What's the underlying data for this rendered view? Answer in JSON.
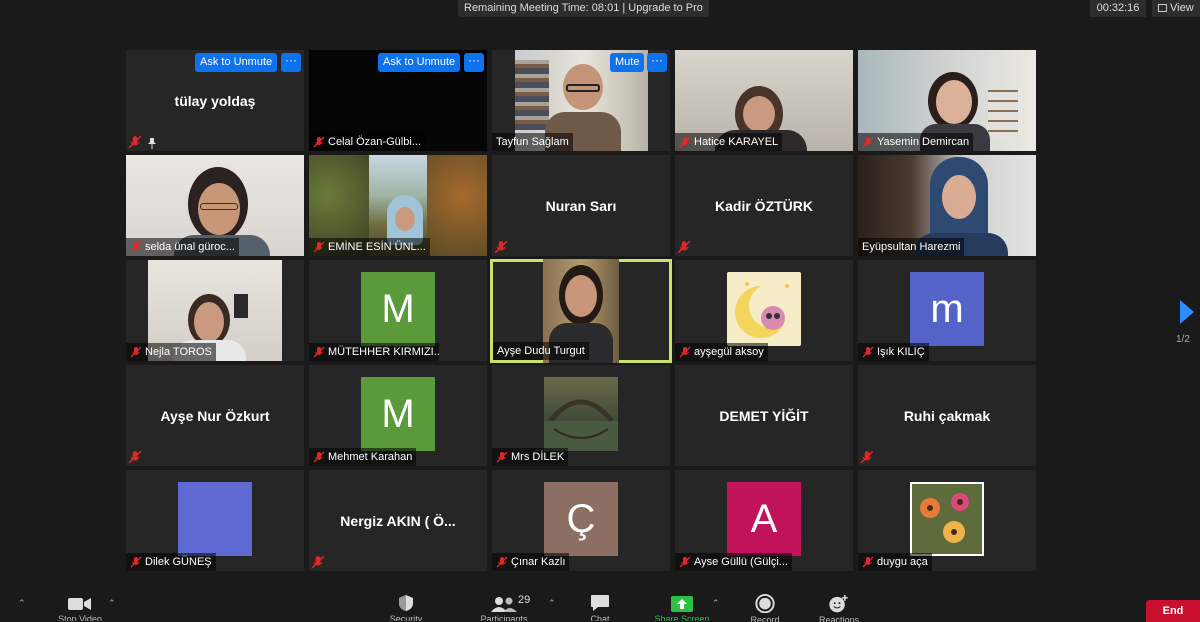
{
  "banner": "Remaining Meeting Time: 08:01 | Upgrade to Pro",
  "timer": "00:32:16",
  "view_label": "View",
  "page_indicator": "1/2",
  "buttons": {
    "ask_to_unmute": "Ask to Unmute",
    "mute": "Mute",
    "more": "···",
    "end": "End"
  },
  "participants": [
    {
      "name": "tülay yoldaş",
      "center_name": "tülay yoldaş"
    },
    {
      "name": "Celal Özan-Gülbi..."
    },
    {
      "name": "Tayfun Sağlam"
    },
    {
      "name": "Hatice KARAYEL"
    },
    {
      "name": "Yasemin Demircan"
    },
    {
      "name": "selda ünal güroc..."
    },
    {
      "name": "EMİNE ESİN ÜNL..."
    },
    {
      "name": "Nuran Sarı",
      "center_name": "Nuran Sarı"
    },
    {
      "name": "Kadir ÖZTÜRK",
      "center_name": "Kadir ÖZTÜRK"
    },
    {
      "name": "Eyüpsultan Harezmi"
    },
    {
      "name": "Nejla TOROS"
    },
    {
      "name": "MÜTEHHER KIRMIZI...",
      "avatar_letter": "M"
    },
    {
      "name": "Ayşe Dudu Turgut"
    },
    {
      "name": "ayşegül aksoy"
    },
    {
      "name": "Işık KILIÇ",
      "avatar_letter": "m"
    },
    {
      "name": "Ayşe Nur Özkurt",
      "center_name": "Ayşe Nur Özkurt"
    },
    {
      "name": "Mehmet Karahan",
      "avatar_letter": "M"
    },
    {
      "name": "Mrs DİLEK"
    },
    {
      "name": "DEMET YİĞİT",
      "center_name": "DEMET YİĞİT"
    },
    {
      "name": "Ruhi çakmak",
      "center_name": "Ruhi çakmak"
    },
    {
      "name": "Dilek GÜNEŞ"
    },
    {
      "name": "Nergiz AKIN ( Ö...",
      "center_name": "Nergiz AKIN ( Ö..."
    },
    {
      "name": "Çınar Kazlı",
      "avatar_letter": "Ç"
    },
    {
      "name": "Ayse Güllü (Gülçi...",
      "avatar_letter": "A"
    },
    {
      "name": "duygu açа"
    }
  ],
  "toolbar": {
    "participants_count": "29",
    "labels": {
      "stop_video": "Stop Video",
      "security": "Security",
      "participants": "Participants",
      "chat": "Chat",
      "share_screen": "Share Screen",
      "record": "Record",
      "reactions": "Reactions"
    }
  },
  "colors": {
    "accent_blue": "#0e72ed",
    "active_speaker": "#c8e16a",
    "end_red": "#c8102e",
    "avatar_green": "#5b9a3b",
    "avatar_indigo": "#5463c8",
    "avatar_brown": "#8c6e63",
    "avatar_magenta": "#c0135a",
    "share_green": "#2ebf46"
  }
}
